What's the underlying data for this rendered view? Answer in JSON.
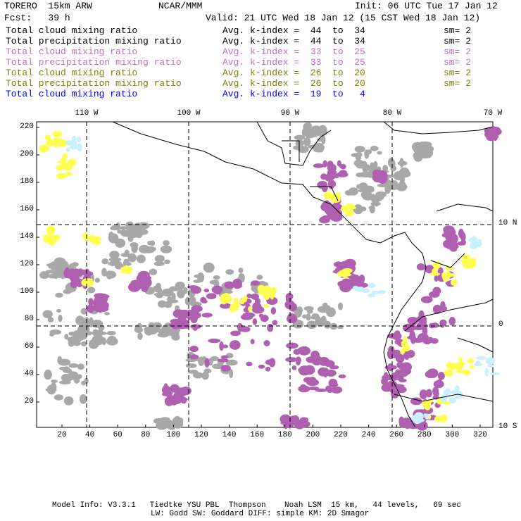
{
  "header": {
    "model": "TORERO  15km ARW",
    "org": "NCAR/MMM",
    "init": "Init: 06 UTC Tue 17 Jan 12",
    "fcst": "Fcst:   39 h",
    "valid": "Valid: 21 UTC Wed 18 Jan 12 (15 CST Wed 18 Jan 12)"
  },
  "legend": [
    {
      "field": "Total cloud mixing ratio",
      "kindex": "Avg. k-index =  44  to  34",
      "sm": "sm= 2",
      "color": "#000000"
    },
    {
      "field": "Total precipitation mixing ratio",
      "kindex": "Avg. k-index =  44  to  34",
      "sm": "sm= 2",
      "color": "#000000"
    },
    {
      "field": "Total cloud mixing ratio",
      "kindex": "Avg. k-index =  33  to  25",
      "sm": "sm= 2",
      "color": "#c070c0"
    },
    {
      "field": "Total precipitation mixing ratio",
      "kindex": "Avg. k-index =  33  to  25",
      "sm": "sm= 2",
      "color": "#c070c0"
    },
    {
      "field": "Total cloud mixing ratio",
      "kindex": "Avg. k-index =  26  to  20",
      "sm": "sm= 2",
      "color": "#808000"
    },
    {
      "field": "Total precipitation mixing ratio",
      "kindex": "Avg. k-index =  26  to  20",
      "sm": "sm= 2",
      "color": "#808000"
    },
    {
      "field": "Total cloud mixing ratio",
      "kindex": "Avg. k-index =  19  to   4",
      "sm": "",
      "color": "#0000ff"
    }
  ],
  "map": {
    "lon_labels": [
      "110 W",
      "100 W",
      "90 W",
      "80 W",
      "70 W"
    ],
    "lat_labels": [
      "10 N",
      "0",
      "10 S"
    ],
    "x_ticks": [
      "20",
      "40",
      "60",
      "80",
      "100",
      "120",
      "140",
      "160",
      "180",
      "200",
      "220",
      "240",
      "260",
      "280",
      "300",
      "320"
    ],
    "y_ticks": [
      "220",
      "200",
      "180",
      "160",
      "140",
      "120",
      "100",
      "80",
      "60",
      "40",
      "20"
    ],
    "colors": {
      "gray": "#a8a8a8",
      "purple": "#b060b0",
      "yellow": "#ffff50",
      "lightblue": "#c8f0ff"
    }
  },
  "footer": {
    "line1": "Model Info: V3.3.1   Tiedtke YSU PBL  Thompson    Noah LSM  15 km,   44 levels,   69 sec",
    "line2": "LW: Godd SW: Goddard DIFF: simple KM: 2D Smagor"
  }
}
